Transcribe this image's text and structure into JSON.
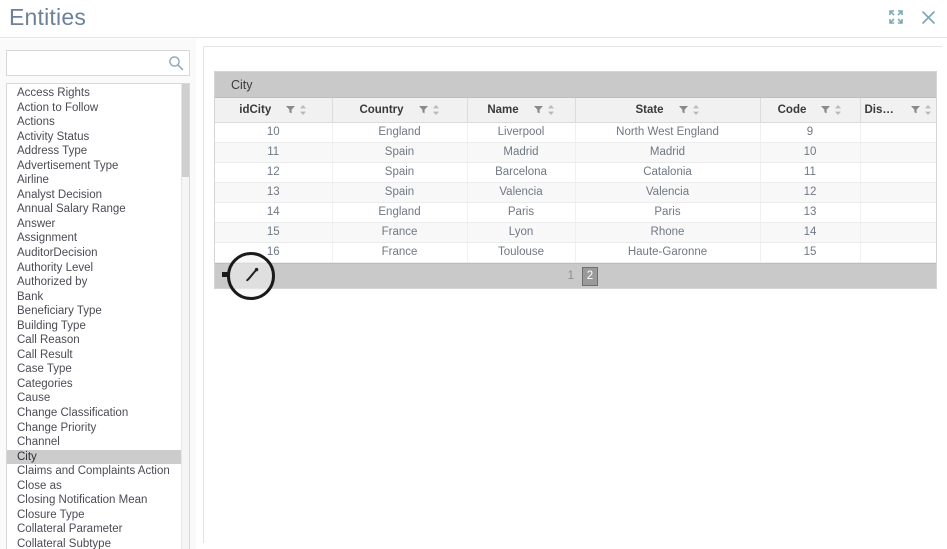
{
  "window": {
    "title": "Entities",
    "expand_icon": "expand-icon",
    "close_icon": "close-icon"
  },
  "sidebar": {
    "search": {
      "value": "",
      "placeholder": "",
      "icon": "search-icon"
    },
    "selected_item": "City",
    "items": [
      "Access Rights",
      "Action to Follow",
      "Actions",
      "Activity Status",
      "Address Type",
      "Advertisement Type",
      "Airline",
      "Analyst Decision",
      "Annual Salary Range",
      "Answer",
      "Assignment",
      "AuditorDecision",
      "Authority Level",
      "Authorized by",
      "Bank",
      "Beneficiary Type",
      "Building Type",
      "Call Reason",
      "Call Result",
      "Case Type",
      "Categories",
      "Cause",
      "Change Classification",
      "Change Priority",
      "Channel",
      "City",
      "Claims and Complaints Action",
      "Close as",
      "Closing Notification Mean",
      "Closure Type",
      "Collateral Parameter",
      "Collateral Subtype"
    ]
  },
  "grid": {
    "caption": "City",
    "columns": [
      {
        "label": "idCity",
        "filter_icon": "filter-icon",
        "sort_icon": "sort-icon"
      },
      {
        "label": "Country",
        "filter_icon": "filter-icon",
        "sort_icon": "sort-icon"
      },
      {
        "label": "Name",
        "filter_icon": "filter-icon",
        "sort_icon": "sort-icon"
      },
      {
        "label": "State",
        "filter_icon": "filter-icon",
        "sort_icon": "sort-icon"
      },
      {
        "label": "Code",
        "filter_icon": "filter-icon",
        "sort_icon": "sort-icon"
      },
      {
        "label": "Disabled",
        "filter_icon": "filter-icon",
        "sort_icon": "sort-icon"
      }
    ],
    "rows": [
      {
        "idCity": "10",
        "Country": "England",
        "Name": "Liverpool",
        "State": "North West England",
        "Code": "9",
        "Disabled": ""
      },
      {
        "idCity": "11",
        "Country": "Spain",
        "Name": "Madrid",
        "State": "Madrid",
        "Code": "10",
        "Disabled": ""
      },
      {
        "idCity": "12",
        "Country": "Spain",
        "Name": "Barcelona",
        "State": "Catalonia",
        "Code": "11",
        "Disabled": ""
      },
      {
        "idCity": "13",
        "Country": "Spain",
        "Name": "Valencia",
        "State": "Valencia",
        "Code": "12",
        "Disabled": ""
      },
      {
        "idCity": "14",
        "Country": "England",
        "Name": "Paris",
        "State": "Paris",
        "Code": "13",
        "Disabled": ""
      },
      {
        "idCity": "15",
        "Country": "France",
        "Name": "Lyon",
        "State": "Rhone",
        "Code": "14",
        "Disabled": ""
      },
      {
        "idCity": "16",
        "Country": "France",
        "Name": "Toulouse",
        "State": "Haute-Garonne",
        "Code": "15",
        "Disabled": ""
      }
    ],
    "pager": {
      "pages": [
        "1",
        "2"
      ],
      "current": "2"
    }
  },
  "colors": {
    "title": "#6e8198",
    "caption_bar": "#c9c9c9",
    "header_row": "#f1f1f1",
    "selected_item": "#cccccc",
    "cell_text": "#707883",
    "icon_teal": "#7fa8b4"
  }
}
